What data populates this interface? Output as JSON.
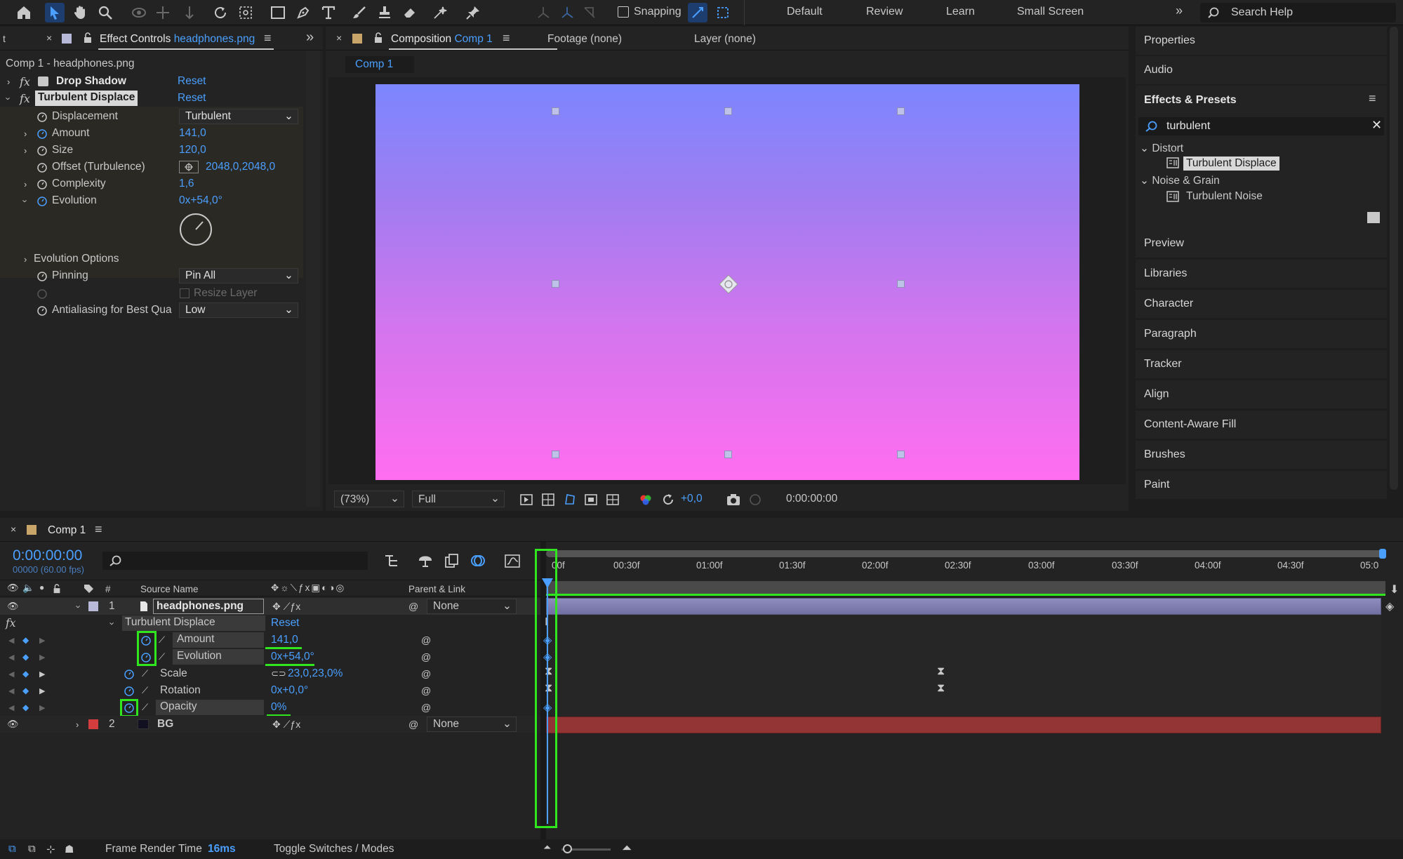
{
  "toolbar": {
    "snapping_label": "Snapping",
    "workspaces": [
      "Default",
      "Review",
      "Learn",
      "Small Screen"
    ],
    "search_placeholder": "Search Help"
  },
  "effect_controls": {
    "tab_prefix": "Effect Controls",
    "tab_layer": "headphones.png",
    "layer_path": "Comp 1 - headphones.png",
    "effects": [
      {
        "name": "Drop Shadow",
        "reset": "Reset"
      },
      {
        "name": "Turbulent Displace",
        "reset": "Reset"
      }
    ],
    "props": {
      "displacement_label": "Displacement",
      "displacement_value": "Turbulent",
      "amount_label": "Amount",
      "amount_value": "141,0",
      "size_label": "Size",
      "size_value": "120,0",
      "offset_label": "Offset (Turbulence)",
      "offset_value": "2048,0,2048,0",
      "complexity_label": "Complexity",
      "complexity_value": "1,6",
      "evolution_label": "Evolution",
      "evolution_value": "0x+54,0°",
      "evolution_options_label": "Evolution Options",
      "pinning_label": "Pinning",
      "pinning_value": "Pin All",
      "resize_label": "Resize Layer",
      "antialias_label": "Antialiasing for Best Qua",
      "antialias_value": "Low"
    }
  },
  "composition": {
    "tab_prefix": "Composition",
    "tab_comp": "Comp 1",
    "footage": "Footage (none)",
    "layer": "Layer (none)",
    "sub_tab": "Comp 1",
    "zoom": "(73%)",
    "resolution": "Full",
    "exposure": "+0,0",
    "timecode": "0:00:00:00",
    "canvas_colors": {
      "top": "#7c86ff",
      "bottom": "#ff6ef0"
    }
  },
  "right_panel": {
    "items_top": [
      "Properties",
      "Audio"
    ],
    "effects_presets_title": "Effects & Presets",
    "search_value": "turbulent",
    "tree": [
      {
        "group": "Distort",
        "item": "Turbulent Displace"
      },
      {
        "group": "Noise & Grain",
        "item": "Turbulent Noise"
      }
    ],
    "items_bottom": [
      "Preview",
      "Libraries",
      "Character",
      "Paragraph",
      "Tracker",
      "Align",
      "Content-Aware Fill",
      "Brushes",
      "Paint"
    ]
  },
  "timeline": {
    "tab": "Comp 1",
    "current_time": "0:00:00:00",
    "frame_info": "00000 (60.00 fps)",
    "columns": {
      "num": "#",
      "source": "Source Name",
      "parent": "Parent & Link"
    },
    "ruler": [
      "00f",
      "00:30f",
      "01:00f",
      "01:30f",
      "02:00f",
      "02:30f",
      "03:00f",
      "03:30f",
      "04:00f",
      "04:30f",
      "05:0"
    ],
    "layer1": {
      "num": "1",
      "name": "headphones.png",
      "parent": "None"
    },
    "effect_group": "Turbulent Displace",
    "effect_reset": "Reset",
    "props": [
      {
        "label": "Amount",
        "value": "141,0"
      },
      {
        "label": "Evolution",
        "value": "0x+54,0°"
      },
      {
        "label": "Scale",
        "value": "23,0,23,0%"
      },
      {
        "label": "Rotation",
        "value": "0x+0,0°"
      },
      {
        "label": "Opacity",
        "value": "0%"
      }
    ],
    "layer2": {
      "num": "2",
      "name": "BG",
      "parent": "None"
    },
    "layer2_color": "#d43d3d",
    "highlight_color": "#2fe61f"
  },
  "status": {
    "render_label": "Frame Render Time",
    "render_value": "16ms",
    "toggle_label": "Toggle Switches / Modes"
  }
}
